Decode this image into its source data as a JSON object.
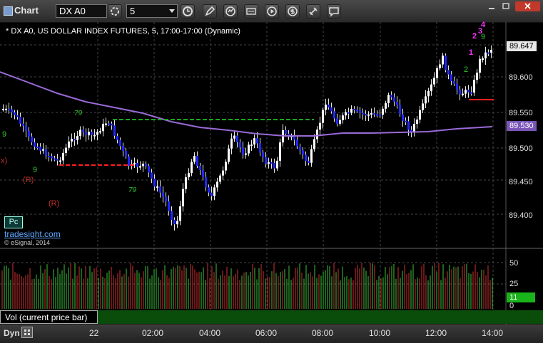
{
  "window": {
    "title": "Chart"
  },
  "toolbar": {
    "symbol": "DX A0",
    "interval": "5"
  },
  "chart": {
    "description": "* DX A0, US DOLLAR INDEX FUTURES, 5, 17:00-17:00 (Dynamic)",
    "price_axis": [
      "89.600",
      "89.550",
      "89.500",
      "89.450",
      "89.400"
    ],
    "current_price": "89.647",
    "ma_value": "89.530",
    "watermark_site": "tradesight.com",
    "watermark_copy": "© eSignal, 2014",
    "pc_label": "Pc",
    "markers": {
      "r1": "(R)",
      "r2": "(R)",
      "x1": "x)",
      "n4": "4",
      "n3": "3",
      "n2": "2",
      "n1": "1",
      "n9a": "9",
      "n9b": "9",
      "g1": "2",
      "g2": "9",
      "g3": "79",
      "g4": "79"
    },
    "colors": {
      "background": "#000000",
      "up_candle": "#ffffff",
      "down_candle": "#1e28ff",
      "ma_line": "#9a6ad8",
      "support": "#ff2020",
      "resistance": "#1fa31f",
      "seq": "#ff33ff"
    }
  },
  "volume_panel": {
    "label": "Vol (current price bar)",
    "axis": [
      "50",
      "25",
      "0"
    ],
    "current_value": "11"
  },
  "time_axis": {
    "mode": "Dyn",
    "labels": [
      "22",
      "02:00",
      "04:00",
      "06:00",
      "08:00",
      "10:00",
      "12:00",
      "14:00"
    ]
  }
}
